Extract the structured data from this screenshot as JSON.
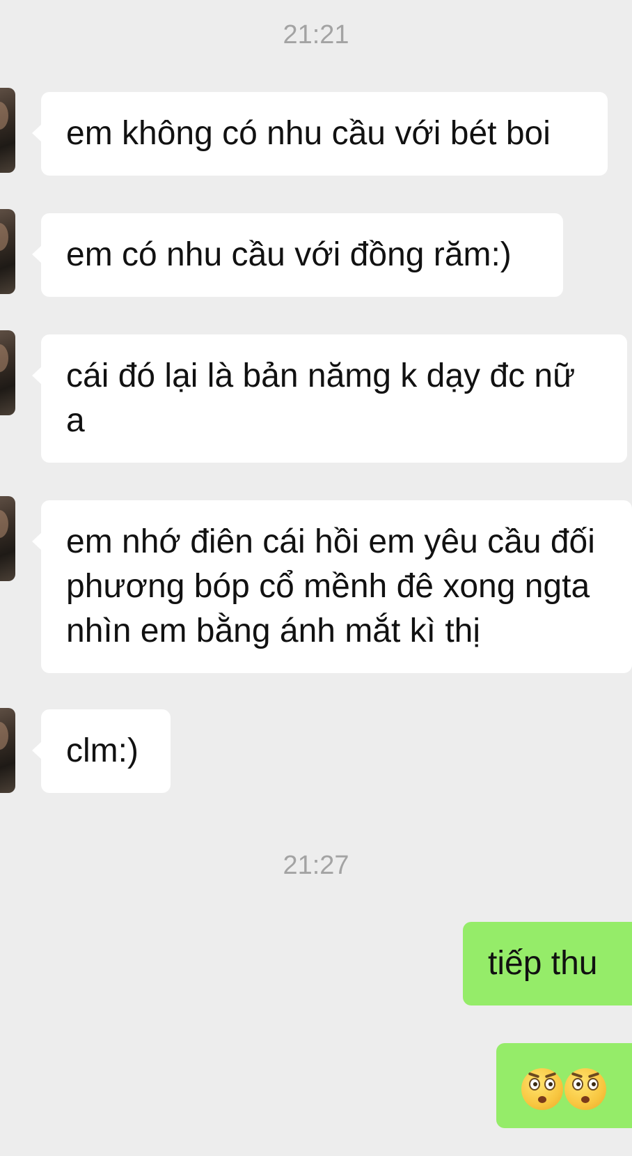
{
  "timestamps": [
    "21:21",
    "21:27"
  ],
  "messages_incoming": [
    {
      "text": "em không có nhu cầu với bét boi"
    },
    {
      "text": "em có nhu cầu với đồng răm:)"
    },
    {
      "text": "cái đó lại là bản nămg k dạy đc nữ a"
    },
    {
      "text": "em nhớ điên cái hồi em yêu cầu đối phương bóp cổ mềnh đê xong ngta nhìn em bằng ánh mắt kì thị"
    },
    {
      "text": "clm:)"
    }
  ],
  "messages_outgoing": [
    {
      "text": "tiếp thu"
    },
    {
      "emoji": [
        "face-with-rolling-eyes-icon",
        "face-with-rolling-eyes-icon"
      ]
    }
  ],
  "colors": {
    "background": "#ededed",
    "incoming_bubble": "#ffffff",
    "outgoing_bubble": "#95ec69",
    "timestamp": "#a3a3a3"
  }
}
